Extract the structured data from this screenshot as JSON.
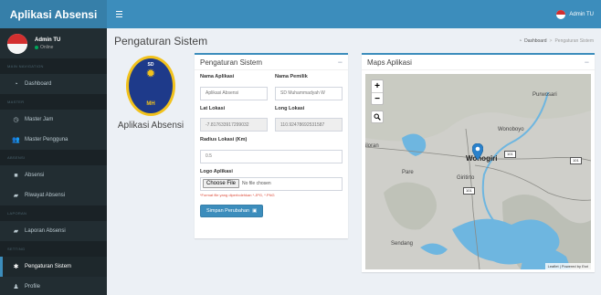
{
  "brand": "Aplikasi Absensi",
  "user": {
    "name": "Admin TU",
    "status": "Online"
  },
  "nav": {
    "headers": [
      "MAIN NAVIGATION",
      "MASTER",
      "ABSENSI",
      "LAPORAN",
      "SETTING"
    ],
    "dashboard": "Dashboard",
    "master_jam": "Master Jam",
    "master_pengguna": "Master Pengguna",
    "absensi": "Absensi",
    "riwayat_absensi": "Riwayat Absensi",
    "laporan_absensi": "Laporan Absensi",
    "pengaturan_sistem": "Pengaturan Sistem",
    "profile": "Profile"
  },
  "topbar": {
    "user_name": "Admin TU"
  },
  "page": {
    "title": "Pengaturan Sistem",
    "breadcrumb": {
      "home": "Dashboard",
      "current": "Pengaturan Sistem"
    }
  },
  "logo": {
    "top_text": "SD",
    "bottom_text": "MH",
    "app_name": "Aplikasi Absensi"
  },
  "settings_box": {
    "title": "Pengaturan Sistem",
    "collapse": "−",
    "fields": {
      "nama_aplikasi": {
        "label": "Nama Aplikasi",
        "value": "Aplikasi Absensi"
      },
      "nama_pemilik": {
        "label": "Nama Pemilik",
        "value": "SD Muhammadyah W"
      },
      "lat_lokasi": {
        "label": "Lat Lokasi",
        "value": "-7.817633917299032"
      },
      "long_lokasi": {
        "label": "Long Lokasi",
        "value": "110.92478692531587"
      },
      "radius": {
        "label": "Radius Lokasi (Km)",
        "value": "0.5"
      },
      "logo": {
        "label": "Logo Aplikasi",
        "button": "Choose File",
        "file_text": "No file chosen",
        "hint": "*Format file yang diperbolehkan *.JPG, *.PNG"
      }
    },
    "save_label": "Simpan Perubahan"
  },
  "map_box": {
    "title": "Maps Aplikasi",
    "collapse": "−",
    "zoom_in": "+",
    "zoom_out": "−",
    "labels": {
      "purwosari": "Purwosari",
      "wonoboyo": "Wonoboyo",
      "wonogiri": "Wonogiri",
      "giritirto": "Giritirto",
      "pare": "Pare",
      "sendang": "Sendang",
      "ngadirojo": "iloran"
    },
    "roads": [
      "101",
      "101",
      "101"
    ],
    "attribution": "Leaflet | Powered by Esri"
  },
  "colors": {
    "primary": "#3c8dbc",
    "primary_dark": "#367fa9",
    "sidebar": "#222d32",
    "danger": "#dd4b39"
  }
}
